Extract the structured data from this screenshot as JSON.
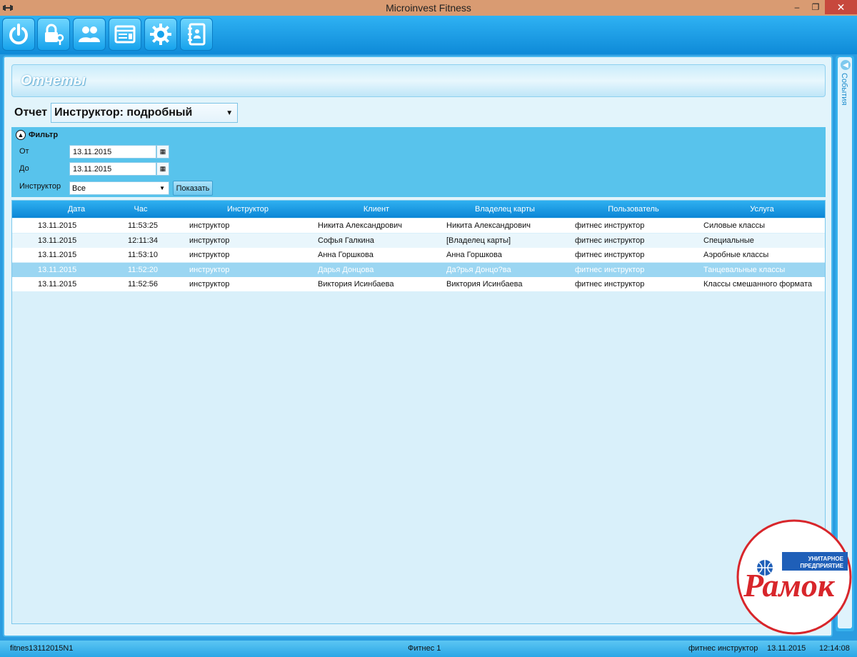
{
  "window": {
    "title": "Microinvest Fitness",
    "minimize": "–",
    "restore": "❐",
    "close": "✕"
  },
  "toolbar": {
    "buttons": [
      "power-icon",
      "lock-key-icon",
      "users-icon",
      "cards-icon",
      "gear-icon",
      "notebook-icon"
    ]
  },
  "header": {
    "title": "Отчеты"
  },
  "report": {
    "label": "Отчет",
    "selected": "Инструктор: подробный"
  },
  "filter": {
    "title": "Фильтр",
    "from_label": "От",
    "from_value": "13.11.2015",
    "to_label": "До",
    "to_value": "13.11.2015",
    "instructor_label": "Инструктор",
    "instructor_value": "Все",
    "show_button": "Показать"
  },
  "table": {
    "columns": [
      "Дата",
      "Час",
      "Инструктор",
      "Клиент",
      "Владелец карты",
      "Пользователь",
      "Услуга"
    ],
    "rows": [
      [
        "13.11.2015",
        "11:53:25",
        "инструктор",
        "Никита Александрович",
        "Никита Александрович",
        "фитнес инструктор",
        "Силовые классы"
      ],
      [
        "13.11.2015",
        "12:11:34",
        "инструктор",
        "Софья Галкина",
        "[Владелец карты]",
        "фитнес инструктор",
        "Специальные"
      ],
      [
        "13.11.2015",
        "11:53:10",
        "инструктор",
        "Анна Горшкова",
        "Анна Горшкова",
        "фитнес инструктор",
        "Аэробные классы"
      ],
      [
        "13.11.2015",
        "11:52:20",
        "инструктор",
        "Дарья Донцова",
        "Да?рья Донцо?ва",
        "фитнес инструктор",
        "Танцевальные классы"
      ],
      [
        "13.11.2015",
        "11:52:56",
        "инструктор",
        "Виктория Исинбаева",
        "Виктория Исинбаева",
        "фитнес инструктор",
        "Классы смешанного формата"
      ]
    ],
    "selected_row": 3
  },
  "side_panel": {
    "label": "События"
  },
  "status": {
    "doc": "fitnes13112015N1",
    "module": "Фитнес 1",
    "user": "фитнес инструктор",
    "date": "13.11.2015",
    "time": "12:14:08"
  },
  "watermark": {
    "line1": "УНИТАРНОЕ",
    "line2": "ПРЕДПРИЯТИЕ",
    "brand": "Рамок"
  },
  "colors": {
    "accent": "#1496e0",
    "titlebar": "#d99b72",
    "close": "#c7483d",
    "selected_row": "#9bd6f2",
    "logo_red": "#d8262b"
  }
}
